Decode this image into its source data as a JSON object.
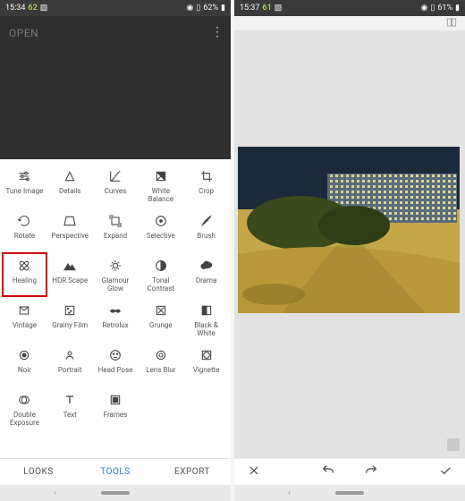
{
  "left": {
    "status": {
      "time": "15:34",
      "accent": "62",
      "battery": "62%"
    },
    "open_label": "OPEN",
    "tools": [
      {
        "label": "Tune Image"
      },
      {
        "label": "Details"
      },
      {
        "label": "Curves"
      },
      {
        "label": "White Balance"
      },
      {
        "label": "Crop"
      },
      {
        "label": "Rotate"
      },
      {
        "label": "Perspective"
      },
      {
        "label": "Expand"
      },
      {
        "label": "Selective"
      },
      {
        "label": "Brush"
      },
      {
        "label": "Healing"
      },
      {
        "label": "HDR Scape"
      },
      {
        "label": "Glamour Glow"
      },
      {
        "label": "Tonal Contrast"
      },
      {
        "label": "Drama"
      },
      {
        "label": "Vintage"
      },
      {
        "label": "Grainy Film"
      },
      {
        "label": "Retrolux"
      },
      {
        "label": "Grunge"
      },
      {
        "label": "Black & White"
      },
      {
        "label": "Noir"
      },
      {
        "label": "Portrait"
      },
      {
        "label": "Head Pose"
      },
      {
        "label": "Lens Blur"
      },
      {
        "label": "Vignette"
      },
      {
        "label": "Double Exposure"
      },
      {
        "label": "Text"
      },
      {
        "label": "Frames"
      }
    ],
    "tabs": {
      "looks": "LOOKS",
      "tools": "TOOLS",
      "export": "EXPORT"
    }
  },
  "right": {
    "status": {
      "time": "15:37",
      "accent": "61",
      "battery": "61%"
    }
  }
}
